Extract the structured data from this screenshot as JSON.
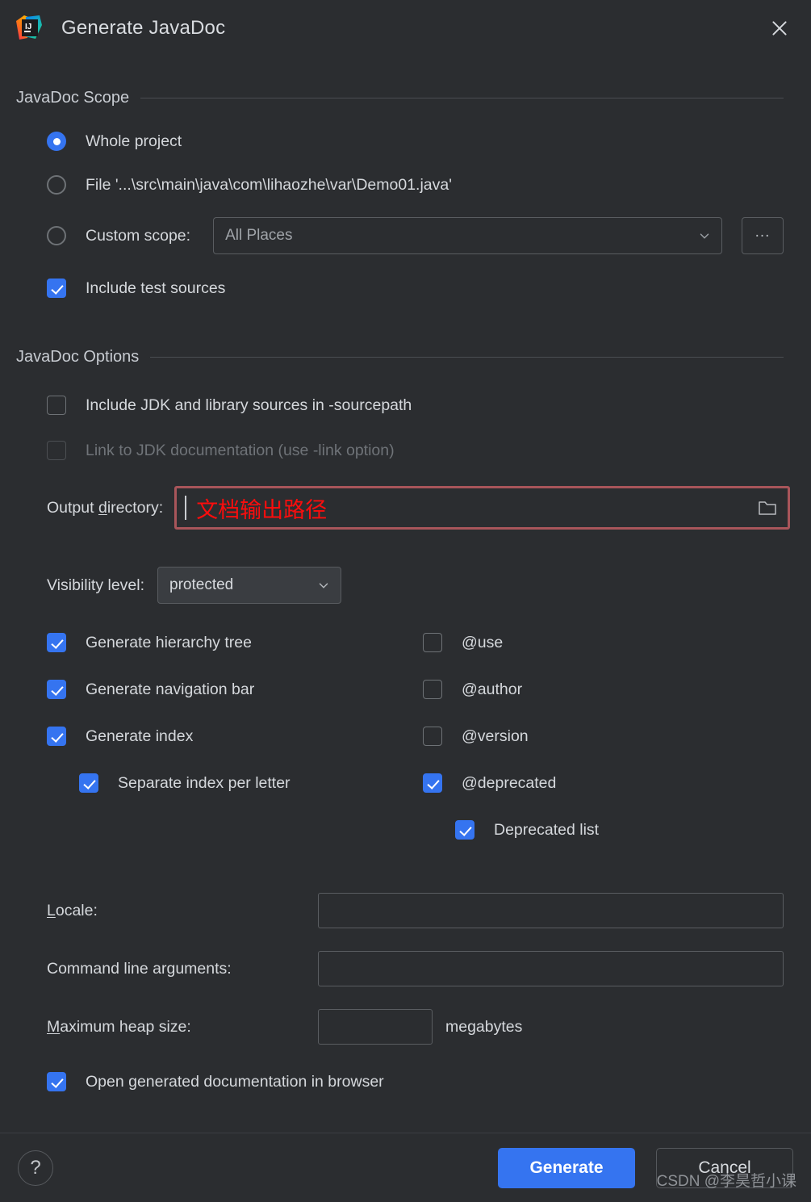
{
  "dialog": {
    "title": "Generate JavaDoc",
    "app_icon": "intellij-idea-icon",
    "close_icon": "close-icon"
  },
  "scope_section": {
    "title": "JavaDoc Scope",
    "options": [
      {
        "label": "Whole project",
        "selected": true
      },
      {
        "label": "File '...\\src\\main\\java\\com\\lihaozhe\\var\\Demo01.java'",
        "selected": false
      },
      {
        "label": "Custom scope:",
        "selected": false
      }
    ],
    "custom_scope_value": "All Places",
    "custom_scope_browse": "...",
    "include_test_sources": {
      "label": "Include test sources",
      "checked": true
    }
  },
  "options_section": {
    "title": "JavaDoc Options",
    "include_jdk": {
      "label": "Include JDK and library sources in -sourcepath",
      "checked": false
    },
    "link_jdk": {
      "label": "Link to JDK documentation (use -link option)",
      "checked": false,
      "disabled": true
    },
    "output_directory": {
      "label_prefix": "Output ",
      "label_mnemonic": "d",
      "label_suffix": "irectory:",
      "value": "文档输出路径",
      "browse_icon": "folder-icon",
      "highlight_color": "#a8555a",
      "text_color": "#fb0d0d"
    },
    "visibility": {
      "label": "Visibility level:",
      "value": "protected"
    },
    "left_checks": [
      {
        "label": "Generate hierarchy tree",
        "checked": true,
        "indent": 0
      },
      {
        "label": "Generate navigation bar",
        "checked": true,
        "indent": 0
      },
      {
        "label": "Generate index",
        "checked": true,
        "indent": 0
      },
      {
        "label": "Separate index per letter",
        "checked": true,
        "indent": 1
      }
    ],
    "right_checks": [
      {
        "label": "@use",
        "checked": false,
        "indent": 0
      },
      {
        "label": "@author",
        "checked": false,
        "indent": 0
      },
      {
        "label": "@version",
        "checked": false,
        "indent": 0
      },
      {
        "label": "@deprecated",
        "checked": true,
        "indent": 0
      },
      {
        "label": "Deprecated list",
        "checked": true,
        "indent": 1
      }
    ],
    "locale": {
      "label_mnemonic": "L",
      "label_suffix": "ocale:",
      "value": ""
    },
    "command_line": {
      "label": "Command line arguments:",
      "value": ""
    },
    "heap": {
      "label_mnemonic": "M",
      "label_suffix": "aximum heap size:",
      "value": "",
      "units": "megabytes"
    },
    "open_in_browser": {
      "label": "Open generated documentation in browser",
      "checked": true
    }
  },
  "footer": {
    "help_label": "?",
    "generate_label": "Generate",
    "cancel_label": "Cancel"
  },
  "watermark": "CSDN @李昊哲小课"
}
